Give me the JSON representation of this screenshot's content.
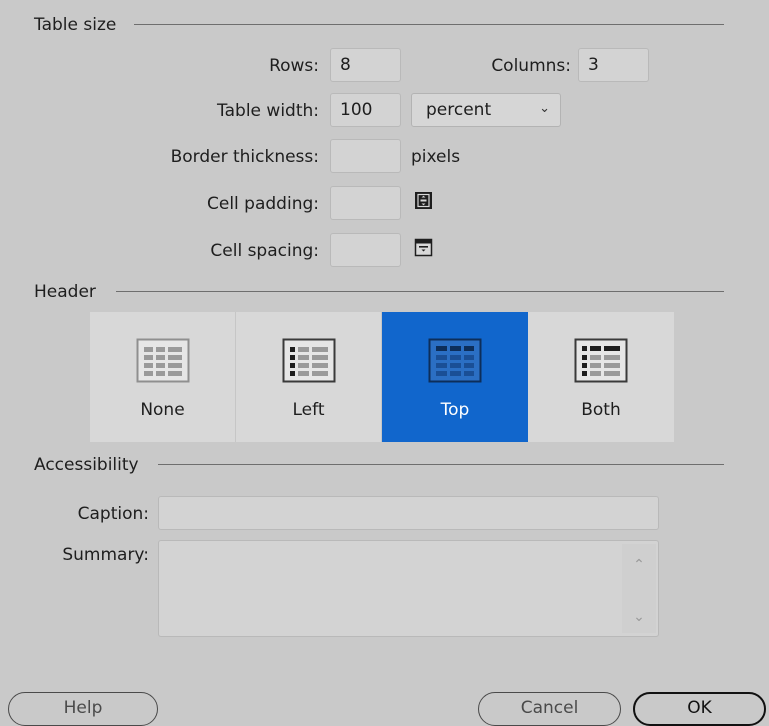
{
  "table_size": {
    "group_label": "Table size",
    "rows_label": "Rows:",
    "rows_value": "8",
    "columns_label": "Columns:",
    "columns_value": "3",
    "width_label": "Table width:",
    "width_value": "100",
    "width_unit": "percent",
    "border_label": "Border thickness:",
    "border_value": "",
    "border_unit": "pixels",
    "padding_label": "Cell padding:",
    "padding_value": "",
    "spacing_label": "Cell spacing:",
    "spacing_value": ""
  },
  "header": {
    "group_label": "Header",
    "options": [
      {
        "label": "None",
        "icon": "table-none-icon"
      },
      {
        "label": "Left",
        "icon": "table-left-header-icon"
      },
      {
        "label": "Top",
        "icon": "table-top-header-icon"
      },
      {
        "label": "Both",
        "icon": "table-both-header-icon"
      }
    ],
    "selected": "Top",
    "accent_color": "#1166cc"
  },
  "accessibility": {
    "group_label": "Accessibility",
    "caption_label": "Caption:",
    "caption_value": "",
    "summary_label": "Summary:",
    "summary_value": ""
  },
  "buttons": {
    "help": "Help",
    "cancel": "Cancel",
    "ok": "OK"
  }
}
